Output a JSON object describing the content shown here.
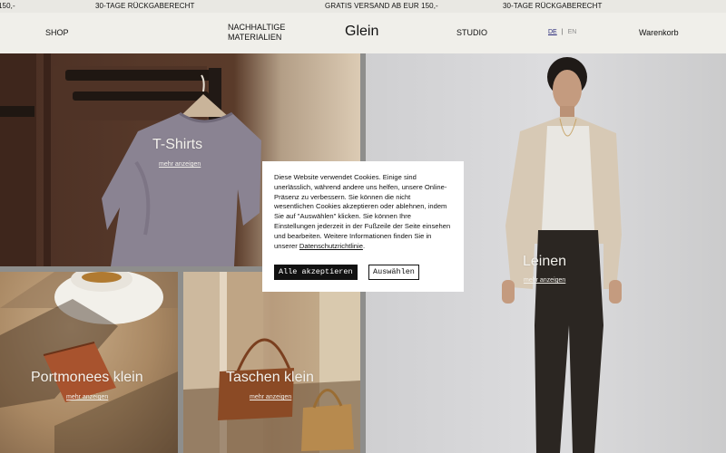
{
  "ticker": {
    "left_fragment": "150,-",
    "return_left": "30-TAGE RÜCKGABERECHT",
    "free_shipping": "GRATIS VERSAND AB EUR 150,-",
    "return_right": "30-TAGE RÜCKGABERECHT"
  },
  "nav": {
    "shop": "SHOP",
    "materials_line1": "NACHHALTIGE",
    "materials_line2": "MATERIALIEN",
    "logo": "Glein",
    "studio": "STUDIO",
    "lang_de": "DE",
    "lang_sep": "|",
    "lang_en": "EN",
    "cart": "Warenkorb"
  },
  "tiles": {
    "tshirts": {
      "title": "T-Shirts",
      "link": "mehr anzeigen"
    },
    "wallets": {
      "title": "Portmonees klein",
      "link": "mehr anzeigen"
    },
    "bags": {
      "title": "Taschen klein",
      "link": "mehr anzeigen"
    },
    "linen": {
      "title": "Leinen",
      "link": "mehr anzeigen"
    }
  },
  "cookie": {
    "text": "Diese Website verwendet Cookies. Einige sind unerlässlich, während andere uns helfen, unsere Online-Präsenz zu verbessern. Sie können die nicht wesentlichen Cookies akzeptieren oder ablehnen, indem Sie auf \"Auswählen\" klicken. Sie können Ihre Einstellungen jederzeit in der Fußzeile der Seite einsehen und bearbeiten. Weitere Informationen finden Sie in unserer ",
    "link": "Datenschutzrichtlinie",
    "end": ".",
    "accept": "Alle akzeptieren",
    "choose": "Auswählen"
  },
  "colors": {
    "ticker_bg": "#e9e8e3",
    "header_bg": "#f0efea",
    "lang_active": "#2b2b7a",
    "tile_text": "#f3f1ec"
  }
}
